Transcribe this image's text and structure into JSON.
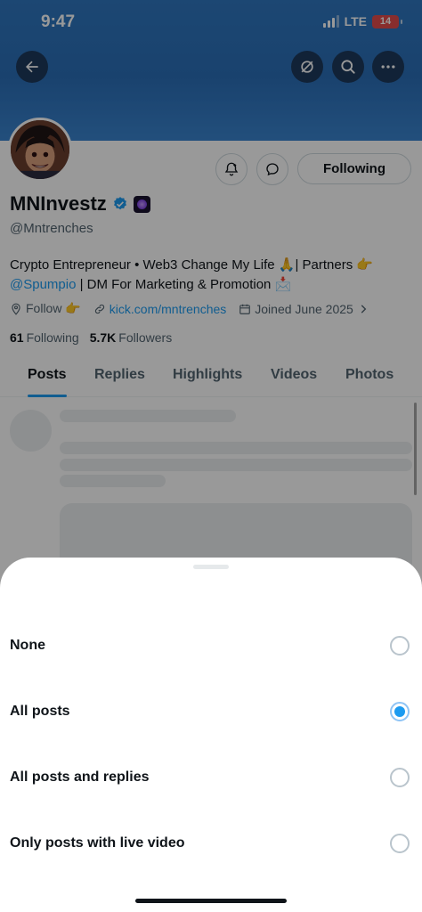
{
  "status_bar": {
    "time": "9:47",
    "network": "LTE",
    "battery": "14"
  },
  "profile": {
    "display_name": "MNInvestz",
    "handle": "@Mntrenches",
    "bio_text": "Crypto Entrepreneur • Web3 Change My Life 🙏| Partners 👉",
    "bio_mention": "@Spumpio",
    "bio_tail": " | DM For Marketing & Promotion 📩",
    "location": "Follow 👉",
    "website": "kick.com/mntrenches",
    "joined": "Joined June 2025",
    "following_count": "61",
    "following_label": "Following",
    "followers_count": "5.7K",
    "followers_label": "Followers",
    "follow_button": "Following"
  },
  "tabs": [
    {
      "label": "Posts",
      "active": true
    },
    {
      "label": "Replies"
    },
    {
      "label": "Highlights"
    },
    {
      "label": "Videos"
    },
    {
      "label": "Photos"
    }
  ],
  "notification_sheet": {
    "options": [
      {
        "label": "None",
        "selected": false
      },
      {
        "label": "All posts",
        "selected": true
      },
      {
        "label": "All posts and replies",
        "selected": false
      },
      {
        "label": "Only posts with live video",
        "selected": false
      }
    ]
  },
  "icons": {
    "back": "back-arrow-icon",
    "grok": "grok-icon",
    "search": "search-icon",
    "more": "more-icon",
    "notify": "bell-icon",
    "message": "message-icon",
    "verified": "verified-badge-icon",
    "location": "location-icon",
    "link": "link-icon",
    "calendar": "calendar-icon"
  },
  "colors": {
    "accent": "#1d9bf0",
    "banner": "#2f77c0",
    "text": "#0f1419",
    "muted": "#536471"
  }
}
